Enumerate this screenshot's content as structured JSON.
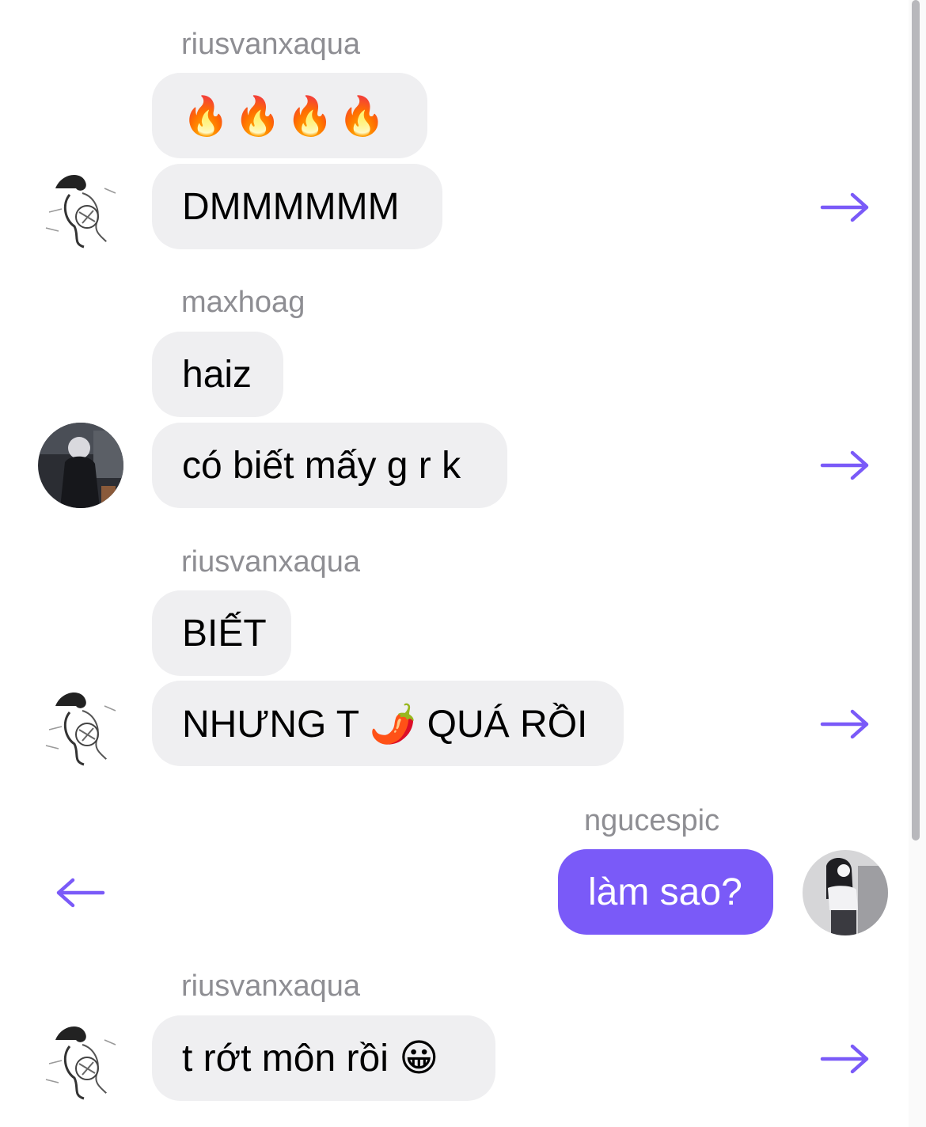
{
  "messages": [
    {
      "sender": "riusvanxaqua",
      "bubbles": [
        "🔥🔥🔥🔥",
        "DMMMMMM"
      ]
    },
    {
      "sender": "maxhoag",
      "bubbles": [
        "haiz",
        "có biết mấy g r k"
      ]
    },
    {
      "sender": "riusvanxaqua",
      "bubbles": [
        "BIẾT",
        "NHƯNG T 🌶️ QUÁ RỒI"
      ]
    },
    {
      "sender": "ngucespic",
      "bubbles": [
        "làm sao?"
      ]
    },
    {
      "sender": "riusvanxaqua",
      "bubbles": [
        "t rớt môn rồi 😀"
      ]
    }
  ],
  "icons": {
    "forward": "arrow-right-icon",
    "back": "arrow-left-icon"
  },
  "colors": {
    "accent": "#7a5af8",
    "incoming_bubble": "#efeff1",
    "sender_text": "#8e8e93"
  }
}
